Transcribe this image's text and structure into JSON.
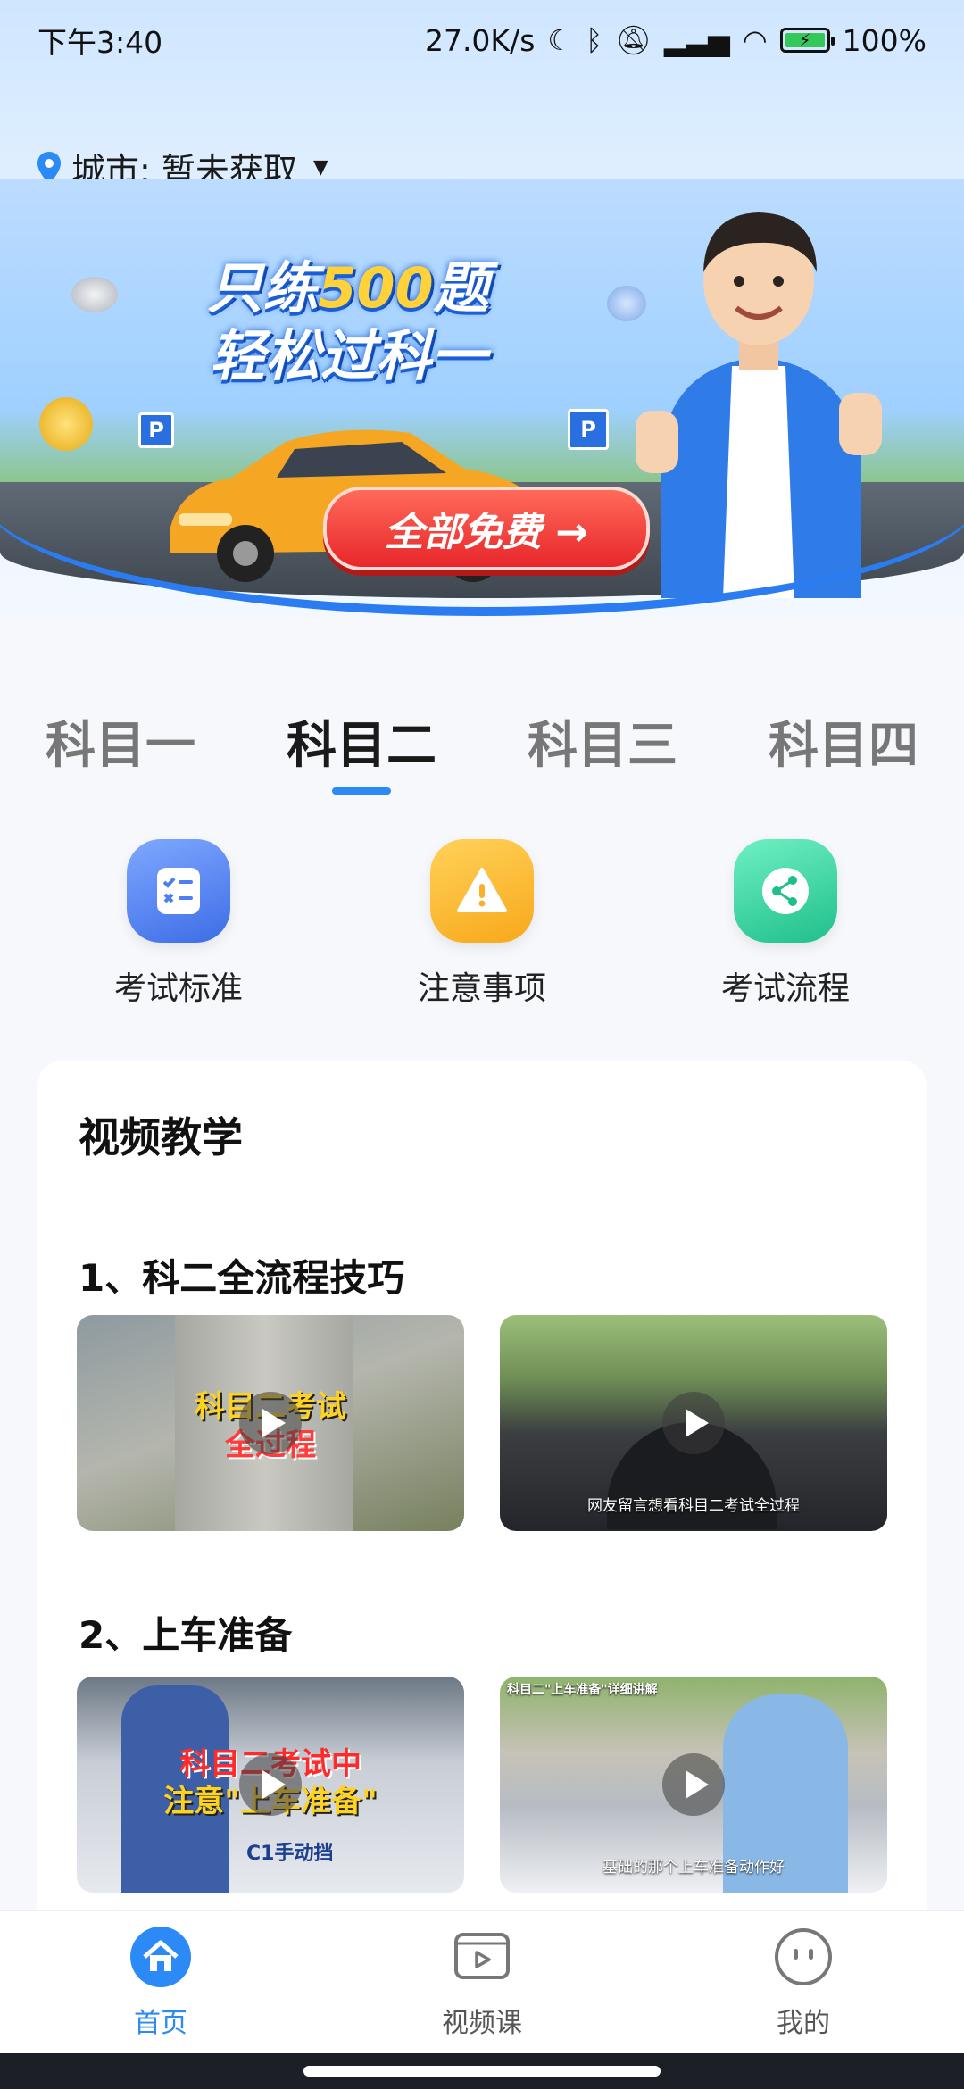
{
  "status_bar": {
    "time": "下午3:40",
    "net_speed": "27.0K/s",
    "battery": "100%"
  },
  "header": {
    "city_label": "城市: 暂未获取"
  },
  "banner": {
    "line1_prefix": "只练",
    "line1_number": "500",
    "line1_suffix": "题",
    "line2": "轻松过科一",
    "cta": "全部免费 →",
    "sign_text": "P"
  },
  "tabs": [
    {
      "label": "科目一",
      "active": false
    },
    {
      "label": "科目二",
      "active": true
    },
    {
      "label": "科目三",
      "active": false
    },
    {
      "label": "科目四",
      "active": false
    }
  ],
  "actions": [
    {
      "label": "考试标准",
      "icon": "checklist-icon"
    },
    {
      "label": "注意事项",
      "icon": "warning-icon"
    },
    {
      "label": "考试流程",
      "icon": "share-flow-icon"
    }
  ],
  "video_section": {
    "title": "视频教学",
    "groups": [
      {
        "title": "1、科二全流程技巧",
        "videos": [
          {
            "caption_top": "科目二考试",
            "caption_bottom": "全过程",
            "subtitle": ""
          },
          {
            "caption_top": "",
            "caption_bottom": "",
            "subtitle": "网友留言想看科目二考试全过程"
          }
        ]
      },
      {
        "title": "2、上车准备",
        "videos": [
          {
            "caption_top": "科目二考试中",
            "caption_bottom": "注意\"上车准备\"",
            "subtitle": "C1手动挡"
          },
          {
            "caption_top": "科目二\"上车准备\"详细讲解",
            "caption_bottom": "",
            "subtitle": "基础的那个上车准备动作好"
          }
        ]
      }
    ]
  },
  "bottom_nav": [
    {
      "label": "首页",
      "icon": "home-icon",
      "active": true
    },
    {
      "label": "视频课",
      "icon": "video-icon",
      "active": false
    },
    {
      "label": "我的",
      "icon": "face-icon",
      "active": false
    }
  ],
  "colors": {
    "accent": "#2b8af5",
    "cta_red": "#e8262a"
  }
}
